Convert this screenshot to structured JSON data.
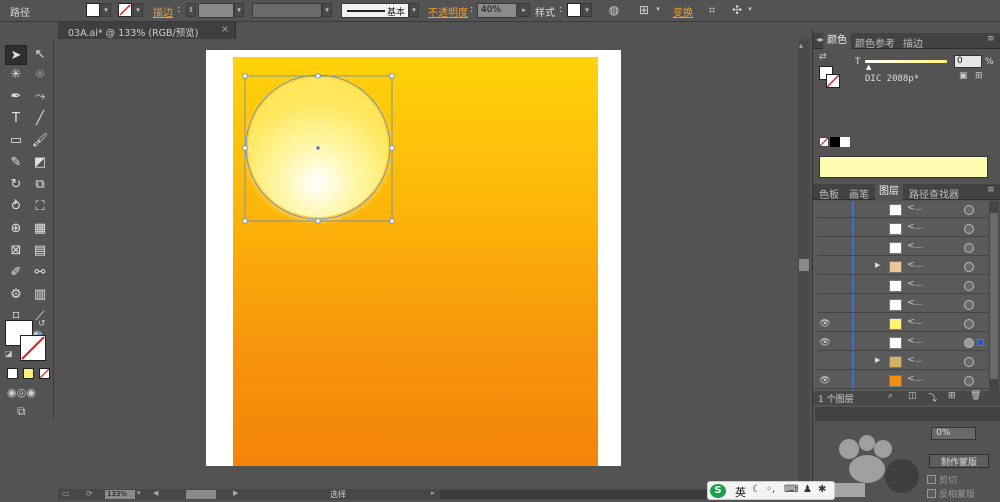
{
  "control_bar": {
    "object_type": "路径",
    "stroke_label": "描边",
    "stroke_style": "基本",
    "opacity_label": "不透明度",
    "opacity_value": "40%",
    "style_label": "样式",
    "transform_label": "变换"
  },
  "document": {
    "tab_title": "03A.ai* @ 133% (RGB/预览)"
  },
  "color_panel": {
    "tabs": [
      "颜色",
      "颜色参考",
      "描边"
    ],
    "tint_label": "T",
    "tint_value": "0",
    "percent": "%",
    "swatch_name": "DIC 2088p*",
    "preview_color": "#fffbb0"
  },
  "layers_panel": {
    "tabs": [
      "色板",
      "画笔",
      "图层",
      "路径查找器"
    ],
    "footer_count": "1 个图层",
    "rows": [
      {
        "name": "<...",
        "eye": false,
        "expand": false,
        "thumb": "#ffffff"
      },
      {
        "name": "<...",
        "eye": false,
        "expand": false,
        "thumb": "#ffffff"
      },
      {
        "name": "<...",
        "eye": false,
        "expand": false,
        "thumb": "#ffffff"
      },
      {
        "name": "<...",
        "eye": false,
        "expand": true,
        "thumb": "#e8c79a"
      },
      {
        "name": "<...",
        "eye": false,
        "expand": false,
        "thumb": "#ffffff"
      },
      {
        "name": "<...",
        "eye": false,
        "expand": false,
        "thumb": "#ffffff"
      },
      {
        "name": "<...",
        "eye": true,
        "expand": false,
        "thumb": "#fff27a"
      },
      {
        "name": "<...",
        "eye": true,
        "expand": false,
        "thumb": "#ffffff"
      },
      {
        "name": "<...",
        "eye": false,
        "expand": true,
        "thumb": "#d4b068"
      },
      {
        "name": "<...",
        "eye": true,
        "expand": false,
        "thumb": "#f09010"
      }
    ]
  },
  "lower_panel": {
    "opacity_text": "0%",
    "button_text": "制作蒙版",
    "clip_label": "剪切",
    "invert_label": "反相蒙版"
  },
  "status_bar": {
    "zoom": "133%",
    "tool_label": "选择"
  },
  "ime_toolbar": {
    "lang": "英"
  },
  "colors": {
    "artboard_gradient_top": "#ffd30a",
    "artboard_gradient_bottom": "#f3840a",
    "sun_inner": "#fffde8",
    "sun_outer": "#ffe04a",
    "accent_link": "#f0a030"
  }
}
